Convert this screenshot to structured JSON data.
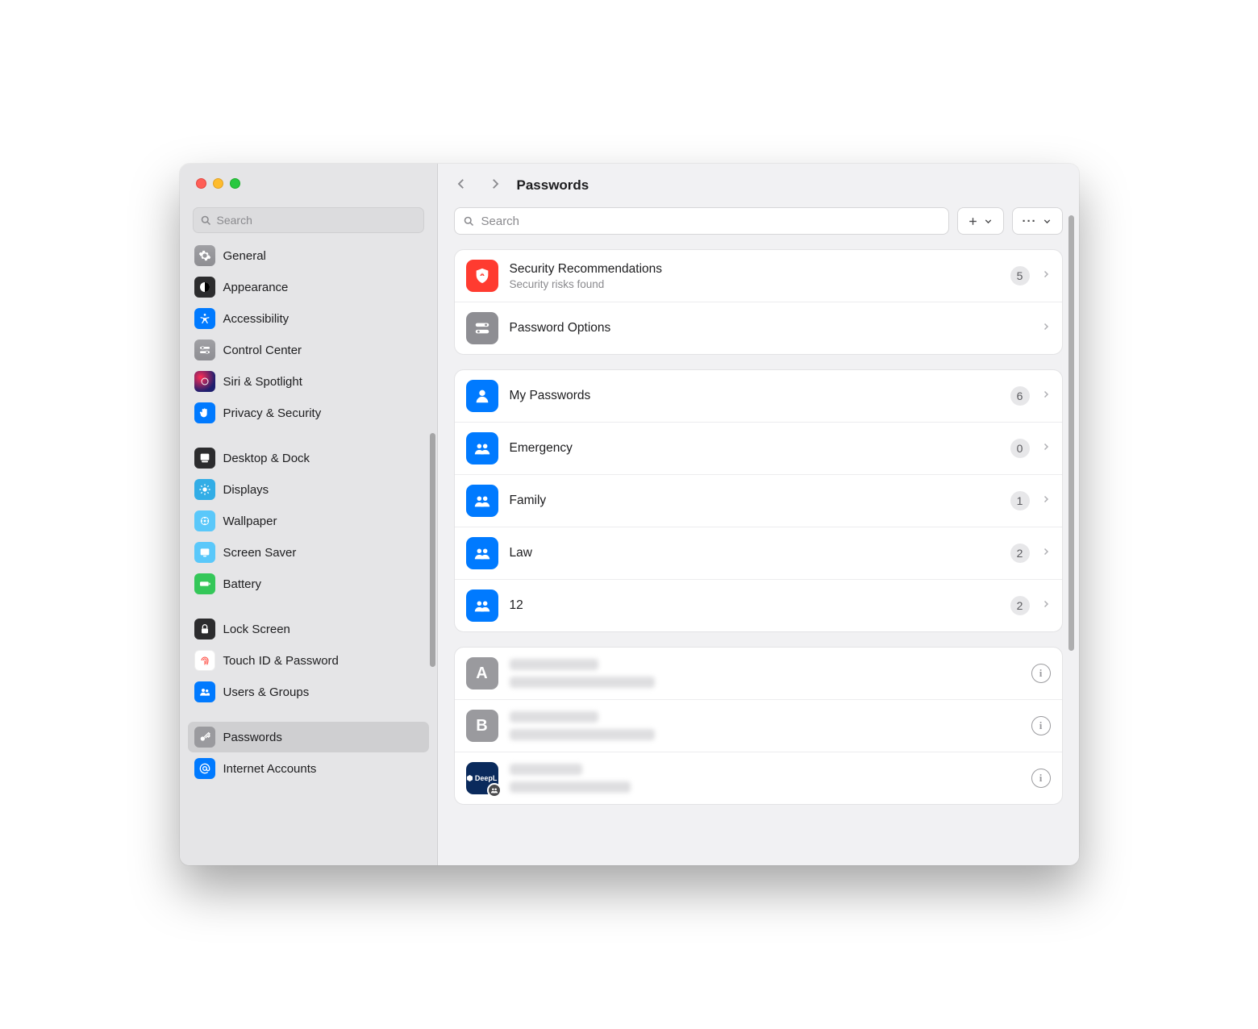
{
  "window": {
    "title": "Passwords"
  },
  "sidebar": {
    "search_placeholder": "Search",
    "items": [
      {
        "label": "General"
      },
      {
        "label": "Appearance"
      },
      {
        "label": "Accessibility"
      },
      {
        "label": "Control Center"
      },
      {
        "label": "Siri & Spotlight"
      },
      {
        "label": "Privacy & Security"
      },
      {
        "label": "Desktop & Dock"
      },
      {
        "label": "Displays"
      },
      {
        "label": "Wallpaper"
      },
      {
        "label": "Screen Saver"
      },
      {
        "label": "Battery"
      },
      {
        "label": "Lock Screen"
      },
      {
        "label": "Touch ID & Password"
      },
      {
        "label": "Users & Groups"
      },
      {
        "label": "Passwords"
      },
      {
        "label": "Internet Accounts"
      }
    ]
  },
  "content": {
    "search_placeholder": "Search",
    "security": {
      "title": "Security Recommendations",
      "subtitle": "Security risks found",
      "count": "5"
    },
    "password_options_label": "Password Options",
    "groups": [
      {
        "label": "My Passwords",
        "count": "6"
      },
      {
        "label": "Emergency",
        "count": "0"
      },
      {
        "label": "Family",
        "count": "1"
      },
      {
        "label": "Law",
        "count": "2"
      },
      {
        "label": "12",
        "count": "2"
      }
    ],
    "entries": [
      {
        "letter": "A",
        "shared": true
      },
      {
        "letter": "B",
        "shared": false
      },
      {
        "letter": "",
        "icon": "deepl",
        "shared": true
      }
    ]
  }
}
